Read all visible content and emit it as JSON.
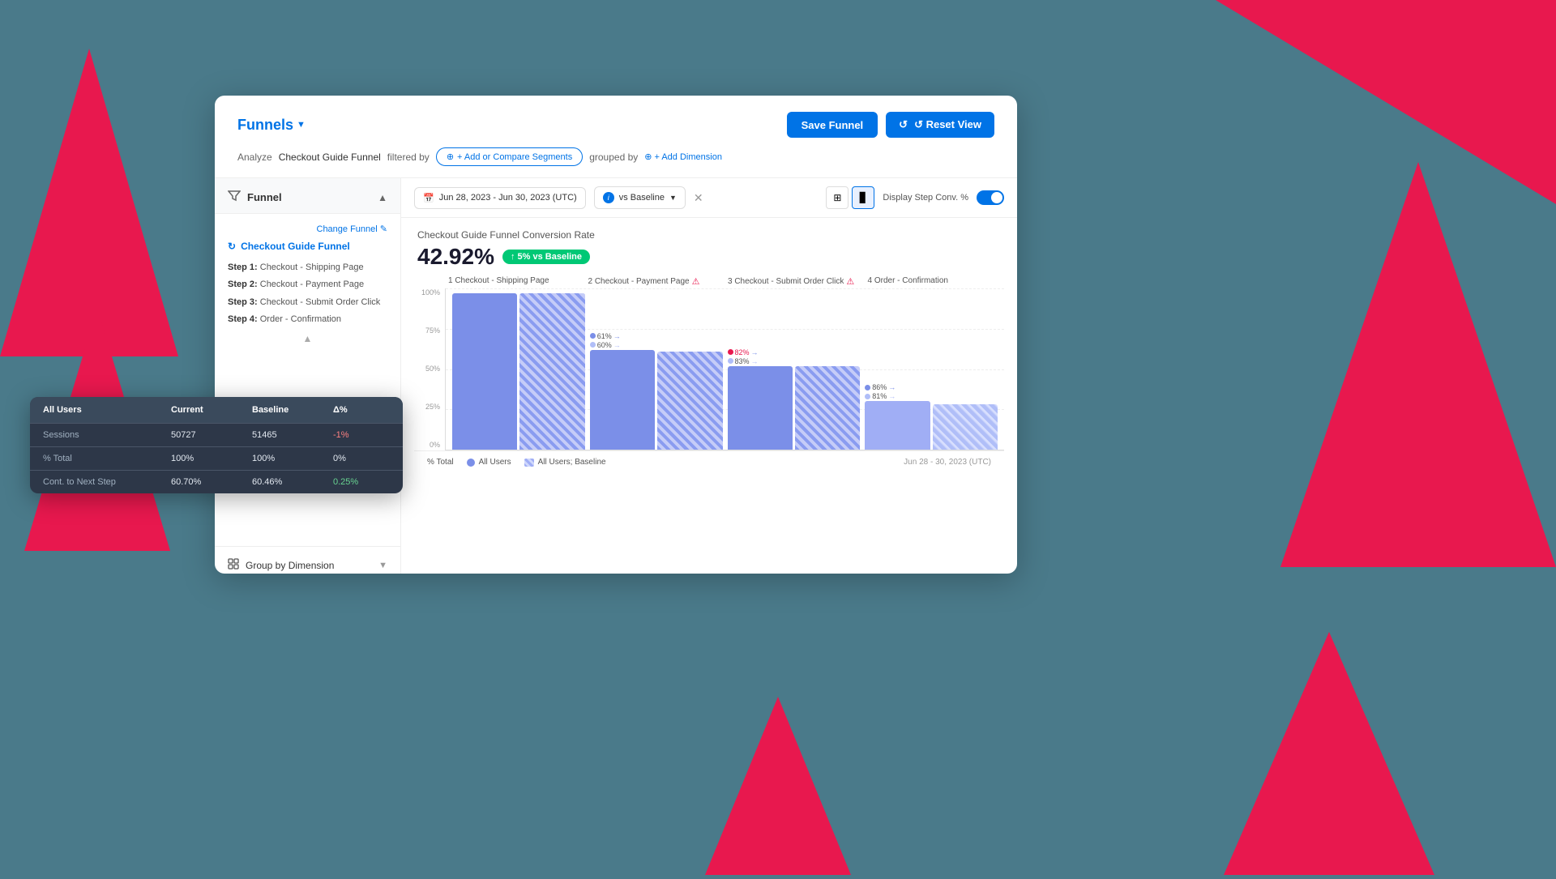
{
  "background": {
    "color": "#4a7a8a"
  },
  "header": {
    "funnels_label": "Funnels",
    "save_funnel_label": "Save Funnel",
    "reset_view_label": "↺ Reset View",
    "analyze_label": "Analyze",
    "funnel_name": "Checkout Guide Funnel",
    "filtered_by_label": "filtered by",
    "add_segments_label": "+ Add or Compare Segments",
    "grouped_by_label": "grouped by",
    "add_dimension_label": "+ Add Dimension"
  },
  "sidebar": {
    "funnel_title": "Funnel",
    "change_funnel_label": "Change Funnel ✎",
    "checkout_guide_name": "Checkout Guide Funnel",
    "steps": [
      {
        "num": "Step 1:",
        "name": "Checkout - Shipping Page"
      },
      {
        "num": "Step 2:",
        "name": "Checkout - Payment Page"
      },
      {
        "num": "Step 3:",
        "name": "Checkout - Submit Order Click"
      },
      {
        "num": "Step 4:",
        "name": "Order - Confirmation"
      }
    ],
    "group_dimension_label": "Group by Dimension"
  },
  "toolbar": {
    "date_range": "Jun 28, 2023 - Jun 30, 2023 (UTC)",
    "vs_baseline": "vs Baseline",
    "display_conv_label": "Display Step Conv. %"
  },
  "chart": {
    "title": "Checkout Guide Funnel Conversion Rate",
    "conv_rate": "42.92%",
    "conv_badge": "↑ 5% vs Baseline",
    "steps": [
      {
        "id": 1,
        "label": "1 Checkout - Shipping Page",
        "bars": [
          {
            "height_pct": 97,
            "type": "solid"
          },
          {
            "height_pct": 97,
            "type": "hatched"
          }
        ],
        "conv_current": null,
        "conv_baseline": null
      },
      {
        "id": 2,
        "label": "2 Checkout - Payment Page",
        "warn": true,
        "bars": [
          {
            "height_pct": 62,
            "type": "solid"
          },
          {
            "height_pct": 61,
            "type": "hatched"
          }
        ],
        "conv_current": "61%",
        "conv_baseline": "60%"
      },
      {
        "id": 3,
        "label": "3 Checkout - Submit Order Click",
        "warn": true,
        "bars": [
          {
            "height_pct": 52,
            "type": "solid"
          },
          {
            "height_pct": 52,
            "type": "hatched"
          }
        ],
        "conv_current": "82%",
        "conv_baseline": "83%"
      },
      {
        "id": 4,
        "label": "4 Order - Confirmation",
        "bars": [
          {
            "height_pct": 30,
            "type": "solid"
          },
          {
            "height_pct": 28,
            "type": "hatched"
          }
        ],
        "conv_current": "86%",
        "conv_baseline": "81%"
      }
    ],
    "y_axis": [
      "100%",
      "75%",
      "50%",
      "25%",
      "0%"
    ],
    "legend": [
      {
        "label": "% Total",
        "color": null
      },
      {
        "label": "All Users",
        "color": "#7b8fe8"
      },
      {
        "label": "All Users; Baseline",
        "color": "#a0b0e8",
        "hatched": true
      }
    ],
    "date_label": "Jun 28 - 30, 2023 (UTC)"
  },
  "dark_table": {
    "title": "All Users",
    "columns": [
      "Current",
      "Baseline",
      "Δ%"
    ],
    "rows": [
      {
        "label": "Sessions",
        "current": "50727",
        "baseline": "51465",
        "delta": "-1%",
        "delta_class": "negative"
      },
      {
        "label": "% Total",
        "current": "100%",
        "baseline": "100%",
        "delta": "0%",
        "delta_class": "neutral"
      },
      {
        "label": "Cont. to Next Step",
        "current": "60.70%",
        "baseline": "60.46%",
        "delta": "0.25%",
        "delta_class": "positive"
      }
    ]
  }
}
